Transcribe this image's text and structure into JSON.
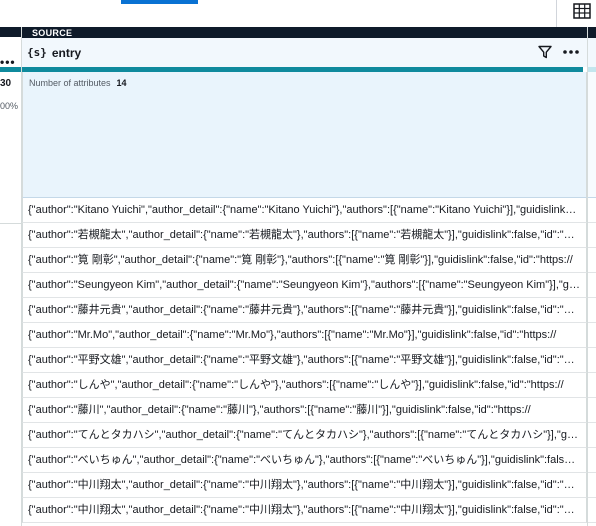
{
  "left_column": {
    "count": "30",
    "percent": "00%"
  },
  "source_column": {
    "section_label": "SOURCE",
    "type_icon": "{s}",
    "name": "entry",
    "attributes_label": "Number of attributes",
    "attributes_count": "14",
    "icons": {
      "filter": "filter-icon",
      "more": "more-actions-icon",
      "grid": "grid-view-icon"
    }
  },
  "rows": [
    "{\"author\":\"Kitano Yuichi\",\"author_detail\":{\"name\":\"Kitano Yuichi\"},\"authors\":[{\"name\":\"Kitano Yuichi\"}],\"guidislink\":false,\"id\":\"https://",
    "{\"author\":\"若槻龍太\",\"author_detail\":{\"name\":\"若槻龍太\"},\"authors\":[{\"name\":\"若槻龍太\"}],\"guidislink\":false,\"id\":\"https://",
    "{\"author\":\"筧 剛彰\",\"author_detail\":{\"name\":\"筧 剛彰\"},\"authors\":[{\"name\":\"筧 剛彰\"}],\"guidislink\":false,\"id\":\"https://",
    "{\"author\":\"Seungyeon Kim\",\"author_detail\":{\"name\":\"Seungyeon Kim\"},\"authors\":[{\"name\":\"Seungyeon Kim\"}],\"guidislink\":false",
    "{\"author\":\"藤井元貴\",\"author_detail\":{\"name\":\"藤井元貴\"},\"authors\":[{\"name\":\"藤井元貴\"}],\"guidislink\":false,\"id\":\"https://",
    "{\"author\":\"Mr.Mo\",\"author_detail\":{\"name\":\"Mr.Mo\"},\"authors\":[{\"name\":\"Mr.Mo\"}],\"guidislink\":false,\"id\":\"https://",
    "{\"author\":\"平野文雄\",\"author_detail\":{\"name\":\"平野文雄\"},\"authors\":[{\"name\":\"平野文雄\"}],\"guidislink\":false,\"id\":\"https://",
    "{\"author\":\"しんや\",\"author_detail\":{\"name\":\"しんや\"},\"authors\":[{\"name\":\"しんや\"}],\"guidislink\":false,\"id\":\"https://",
    "{\"author\":\"藤川\",\"author_detail\":{\"name\":\"藤川\"},\"authors\":[{\"name\":\"藤川\"}],\"guidislink\":false,\"id\":\"https://",
    "{\"author\":\"てんとタカハシ\",\"author_detail\":{\"name\":\"てんとタカハシ\"},\"authors\":[{\"name\":\"てんとタカハシ\"}],\"guidislink\":false",
    "{\"author\":\"べいちゅん\",\"author_detail\":{\"name\":\"べいちゅん\"},\"authors\":[{\"name\":\"べいちゅん\"}],\"guidislink\":false,\"id\":\"https://",
    "{\"author\":\"中川翔太\",\"author_detail\":{\"name\":\"中川翔太\"},\"authors\":[{\"name\":\"中川翔太\"}],\"guidislink\":false,\"id\":\"https://",
    "{\"author\":\"中川翔太\",\"author_detail\":{\"name\":\"中川翔太\"},\"authors\":[{\"name\":\"中川翔太\"}],\"guidislink\":false,\"id\":\"https://"
  ],
  "colors": {
    "accent_teal": "#0f8a9d",
    "header_dark": "#0f1b2a",
    "header_bg": "#f2f8fd",
    "profile_bg": "#e9f4fc",
    "tab_blue": "#0972d3"
  }
}
